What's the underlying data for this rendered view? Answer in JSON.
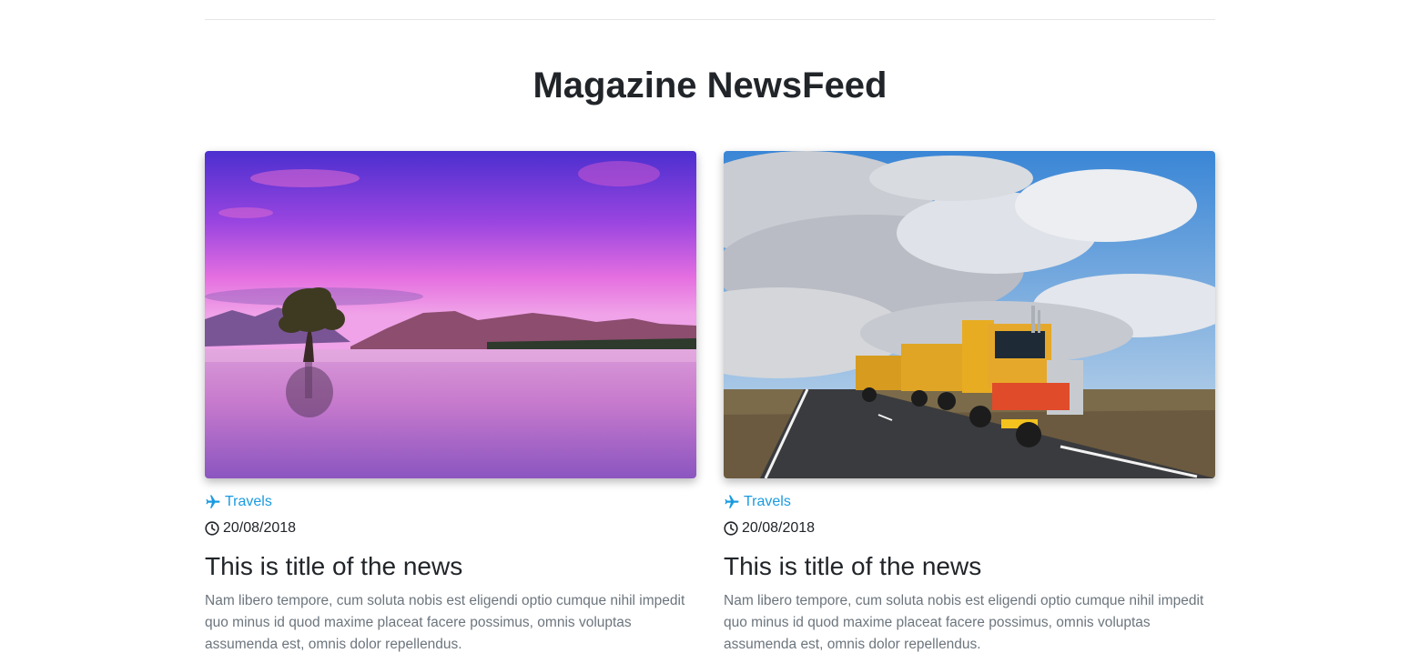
{
  "page": {
    "title": "Magazine NewsFeed"
  },
  "colors": {
    "accent": "#1a9be0",
    "heading": "#212529",
    "body_text": "#6c757d",
    "divider": "#e6e6e6"
  },
  "cards": [
    {
      "image_subject": "purple lake sunset with lone tree",
      "category": "Travels",
      "category_icon": "plane-icon",
      "date": "20/08/2018",
      "date_icon": "clock-icon",
      "title": "This is title of the news",
      "body": "Nam libero tempore, cum soluta nobis est eligendi optio cumque nihil impedit quo minus id quod maxime placeat facere possimus, omnis voluptas assumenda est, omnis dolor repellendus."
    },
    {
      "image_subject": "road train truck on highway under cloudy sky",
      "category": "Travels",
      "category_icon": "plane-icon",
      "date": "20/08/2018",
      "date_icon": "clock-icon",
      "title": "This is title of the news",
      "body": "Nam libero tempore, cum soluta nobis est eligendi optio cumque nihil impedit quo minus id quod maxime placeat facere possimus, omnis voluptas assumenda est, omnis dolor repellendus."
    }
  ]
}
